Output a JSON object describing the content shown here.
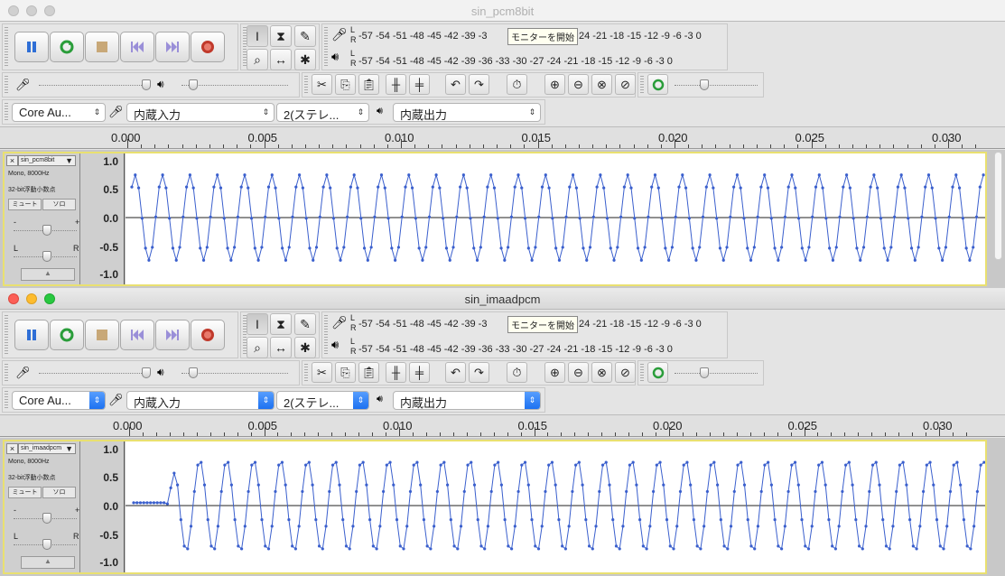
{
  "windows": [
    {
      "title": "sin_pcm8bit",
      "track_name": "sin_pcm8bit",
      "active": false,
      "wave": {
        "amplitude": 0.75,
        "cycles": 32,
        "onset": 0
      }
    },
    {
      "title": "sin_imaadpcm",
      "track_name": "sin_imaadpcm",
      "active": true,
      "wave": {
        "amplitude": 0.8,
        "cycles": 32,
        "onset": 0.0012
      }
    }
  ],
  "meter": {
    "rec_scale": "-57 -54 -51 -48 -45 -42 -39 -3",
    "rec_scale_tail": "24 -21 -18 -15 -12  -9  -6  -3  0",
    "play_scale": "-57 -54 -51 -48 -45 -42 -39 -36 -33 -30 -27 -24 -21 -18 -15 -12  -9  -6  -3  0",
    "channel_l": "L",
    "channel_r": "R",
    "tooltip": "モニターを開始"
  },
  "devices": {
    "host": "Core Au...",
    "input": "内蔵入力",
    "channels": "2(ステレ...",
    "output": "内蔵出力"
  },
  "ruler": {
    "labels": [
      "0.000",
      "0.005",
      "0.010",
      "0.015",
      "0.020",
      "0.025",
      "0.030"
    ]
  },
  "track": {
    "format": "Mono, 8000Hz",
    "sample_format": "32-bit浮動小数点",
    "mute": "ミュート",
    "solo": "ソロ",
    "gain_minus": "-",
    "gain_plus": "+",
    "pan_l": "L",
    "pan_r": "R",
    "close": "×",
    "y_labels": [
      "1.0",
      "0.5",
      "0.0",
      "-0.5",
      "-1.0"
    ]
  },
  "icons": {
    "pause": "pause-icon",
    "loop": "loop-icon",
    "stop": "stop-icon",
    "skip_start": "skip-start-icon",
    "skip_end": "skip-end-icon",
    "record": "record-icon"
  },
  "colors": {
    "waveform": "#3a5fcd",
    "track_border": "#e9e070",
    "pause_blue": "#2f6fd6",
    "record_red": "#c0392b"
  }
}
